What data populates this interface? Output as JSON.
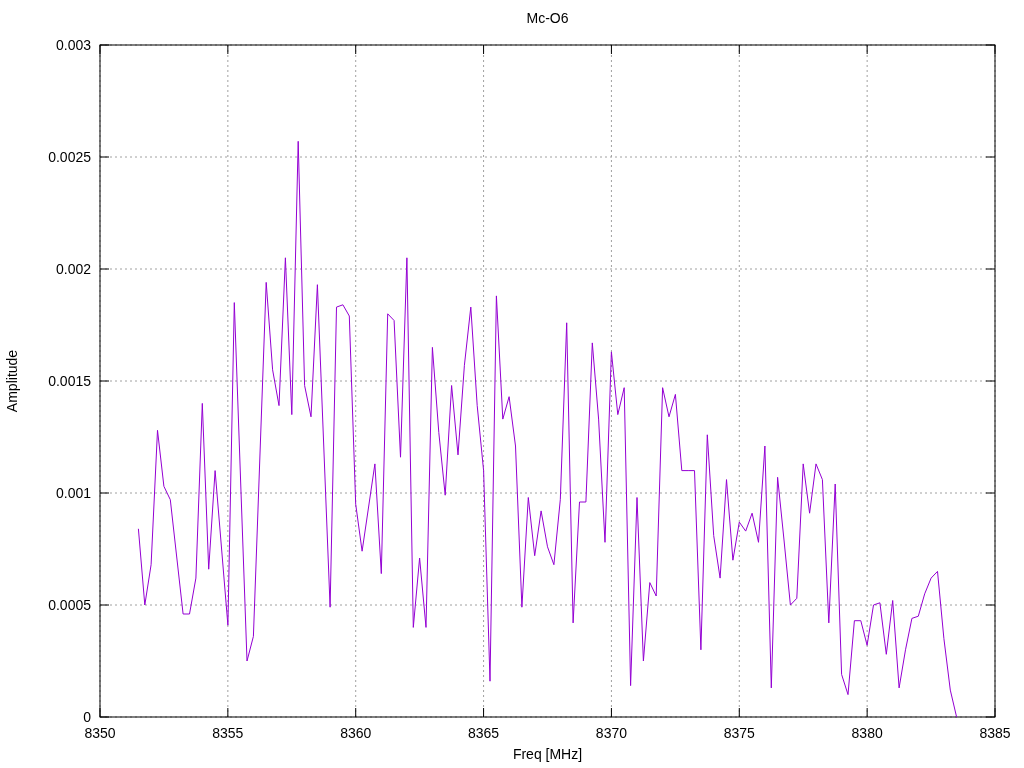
{
  "chart": {
    "chart_data": {
      "type": "line",
      "title": "Mc-O6",
      "xlabel": "Freq [MHz]",
      "ylabel": "Amplitude",
      "grid": true,
      "xlim": [
        8350,
        8385
      ],
      "ylim": [
        0,
        0.003
      ],
      "xticks": [
        8350,
        8355,
        8360,
        8365,
        8370,
        8375,
        8380,
        8385
      ],
      "yticks": [
        0,
        0.0005,
        0.001,
        0.0015,
        0.002,
        0.0025,
        0.003
      ],
      "x": [
        8351.5,
        8351.75,
        8352,
        8352.25,
        8352.5,
        8352.75,
        8353.25,
        8353.5,
        8353.75,
        8354,
        8354.25,
        8354.5,
        8355,
        8355.25,
        8355.75,
        8356,
        8356.5,
        8356.75,
        8357,
        8357.25,
        8357.5,
        8357.75,
        8358,
        8358.25,
        8358.5,
        8359,
        8359.25,
        8359.5,
        8359.75,
        8360,
        8360.25,
        8360.75,
        8361,
        8361.25,
        8361.5,
        8361.75,
        8362,
        8362.25,
        8362.5,
        8362.75,
        8363,
        8363.25,
        8363.5,
        8363.75,
        8364,
        8364.25,
        8364.5,
        8364.75,
        8365,
        8365.25,
        8365.5,
        8365.75,
        8366,
        8366.25,
        8366.5,
        8366.75,
        8367,
        8367.25,
        8367.5,
        8367.75,
        8368,
        8368.25,
        8368.5,
        8368.75,
        8369,
        8369.25,
        8369.5,
        8369.75,
        8370,
        8370.25,
        8370.5,
        8370.75,
        8371,
        8371.25,
        8371.5,
        8371.75,
        8372,
        8372.25,
        8372.5,
        8372.75,
        8373,
        8373.25,
        8373.5,
        8373.75,
        8374,
        8374.25,
        8374.5,
        8374.75,
        8375,
        8375.25,
        8375.5,
        8375.75,
        8376,
        8376.25,
        8376.5,
        8376.75,
        8377,
        8377.25,
        8377.5,
        8377.75,
        8378,
        8378.25,
        8378.5,
        8378.75,
        8379,
        8379.25,
        8379.5,
        8379.75,
        8380,
        8380.25,
        8380.5,
        8380.75,
        8381,
        8381.25,
        8381.5,
        8381.75,
        8382,
        8382.25,
        8382.5,
        8382.75,
        8383,
        8383.25,
        8383.5
      ],
      "series": [
        {
          "color": "#9400d3",
          "values": [
            0.00084,
            0.0005,
            0.00068,
            0.00128,
            0.00103,
            0.00097,
            0.00046,
            0.00046,
            0.00062,
            0.0014,
            0.00066,
            0.0011,
            0.00041,
            0.00185,
            0.00025,
            0.00036,
            0.00194,
            0.00155,
            0.00139,
            0.00205,
            0.00135,
            0.00257,
            0.00148,
            0.00134,
            0.00193,
            0.00049,
            0.00183,
            0.00184,
            0.00179,
            0.00095,
            0.00074,
            0.00113,
            0.00064,
            0.0018,
            0.00177,
            0.00116,
            0.00205,
            0.0004,
            0.00071,
            0.0004,
            0.00165,
            0.00127,
            0.00099,
            0.00148,
            0.00117,
            0.00157,
            0.00183,
            0.00139,
            0.0011,
            0.00016,
            0.00188,
            0.00133,
            0.00143,
            0.00121,
            0.00049,
            0.00098,
            0.00072,
            0.00092,
            0.00076,
            0.00068,
            0.00097,
            0.00176,
            0.00042,
            0.00096,
            0.00096,
            0.00167,
            0.00133,
            0.00078,
            0.00163,
            0.00135,
            0.00147,
            0.00014,
            0.00098,
            0.00025,
            0.0006,
            0.00054,
            0.00147,
            0.00134,
            0.00144,
            0.0011,
            0.0011,
            0.0011,
            0.0003,
            0.00126,
            0.00081,
            0.00062,
            0.00106,
            0.0007,
            0.00087,
            0.00083,
            0.00091,
            0.00078,
            0.00121,
            0.00013,
            0.00107,
            0.00079,
            0.0005,
            0.00053,
            0.00113,
            0.00091,
            0.00113,
            0.00106,
            0.00042,
            0.00104,
            0.00019,
            0.0001,
            0.00043,
            0.00043,
            0.00032,
            0.0005,
            0.00051,
            0.00028,
            0.00052,
            0.00013,
            0.0003,
            0.00044,
            0.00045,
            0.00055,
            0.00062,
            0.00065,
            0.00035,
            0.00012,
            0
          ]
        }
      ]
    }
  }
}
